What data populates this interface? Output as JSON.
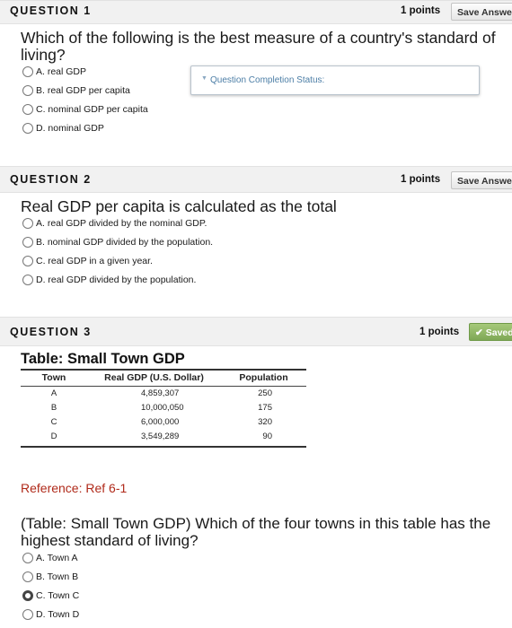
{
  "q1": {
    "label": "QUESTION 1",
    "points": "1 points",
    "save": "Save Answer",
    "prompt": "Which of the following is the best measure of a country's standard of living?",
    "options": [
      "A. real GDP",
      "B. real GDP per capita",
      "C. nominal GDP per capita",
      "D. nominal GDP"
    ],
    "status_label": "Question Completion Status:"
  },
  "q2": {
    "label": "QUESTION 2",
    "points": "1 points",
    "save": "Save Answer",
    "prompt": "Real GDP per capita is calculated as the total",
    "options": [
      "A. real GDP divided by the nominal GDP.",
      "B. nominal GDP divided by the population.",
      "C. real GDP in a given year.",
      "D. real GDP divided by the population."
    ]
  },
  "q3": {
    "label": "QUESTION 3",
    "points": "1 points",
    "save": "Saved",
    "table": {
      "title": "Table: Small Town GDP",
      "headers": [
        "Town",
        "Real GDP (U.S. Dollar)",
        "Population"
      ],
      "rows": [
        [
          "A",
          "4,859,307",
          "250"
        ],
        [
          "B",
          "10,000,050",
          "175"
        ],
        [
          "C",
          "6,000,000",
          "320"
        ],
        [
          "D",
          "3,549,289",
          "90"
        ]
      ]
    },
    "reference": "Reference: Ref 6-1",
    "prompt": "(Table: Small Town GDP) Which of the four towns in this table has the highest standard of living?",
    "options": [
      "A. Town A",
      "B. Town B",
      "C. Town C",
      "D. Town D"
    ],
    "selected": "C. Town C"
  }
}
